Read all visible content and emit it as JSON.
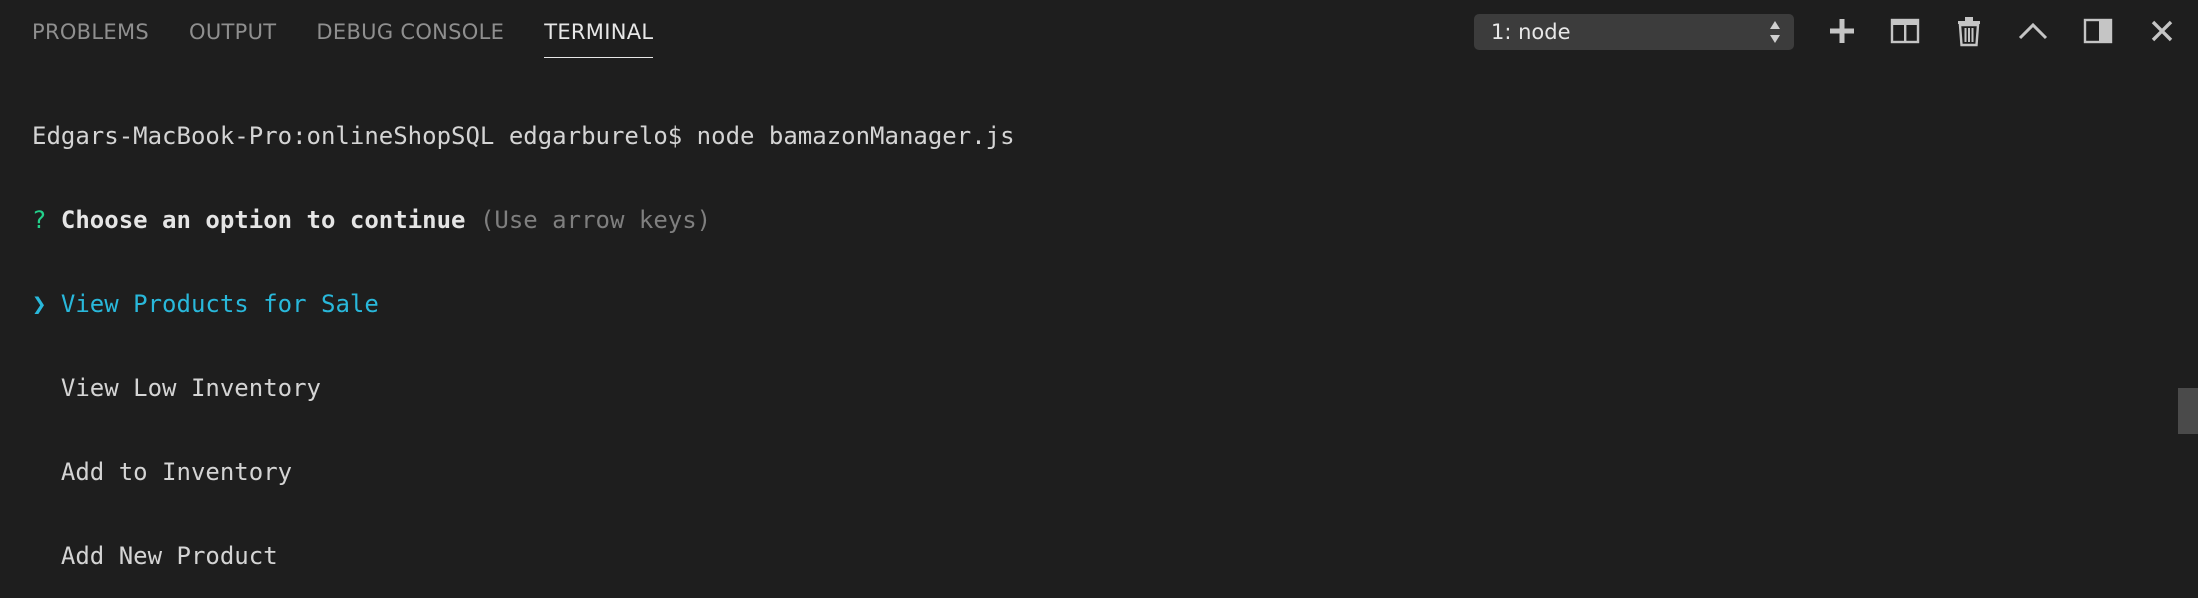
{
  "panel": {
    "tabs": [
      {
        "label": "PROBLEMS",
        "active": false
      },
      {
        "label": "OUTPUT",
        "active": false
      },
      {
        "label": "DEBUG CONSOLE",
        "active": false
      },
      {
        "label": "TERMINAL",
        "active": true
      }
    ],
    "terminal_select": {
      "value": "1: node"
    },
    "actions": [
      {
        "icon": "plus-icon",
        "title": "New Terminal"
      },
      {
        "icon": "split-icon",
        "title": "Split Terminal"
      },
      {
        "icon": "trash-icon",
        "title": "Kill Terminal"
      },
      {
        "icon": "chevron-up-icon",
        "title": "Maximize Panel Size"
      },
      {
        "icon": "toggle-sidebar-icon",
        "title": "Move Panel"
      },
      {
        "icon": "close-icon",
        "title": "Close Panel"
      }
    ]
  },
  "terminal": {
    "prompt_line": "Edgars-MacBook-Pro:onlineShopSQL edgarburelo$ node bamazonManager.js",
    "question_mark": "?",
    "question": "Choose an option to continue",
    "hint": "(Use arrow keys)",
    "pointer": "❯",
    "options": [
      {
        "label": "View Products for Sale",
        "selected": true
      },
      {
        "label": "View Low Inventory",
        "selected": false
      },
      {
        "label": "Add to Inventory",
        "selected": false
      },
      {
        "label": "Add New Product",
        "selected": false
      }
    ]
  },
  "colors": {
    "background": "#1e1e1e",
    "question_mark": "#23d18b",
    "selected_option": "#29b8db",
    "hint": "#7f7f7f"
  }
}
